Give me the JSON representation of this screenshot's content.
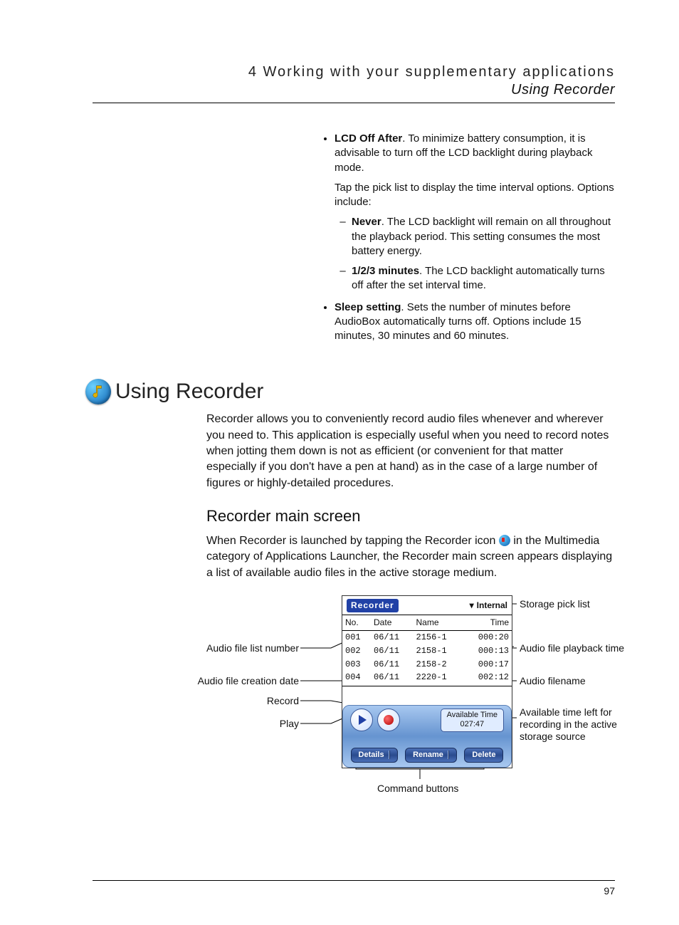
{
  "header": {
    "chapter": "4 Working with your supplementary applications",
    "subtitle": "Using Recorder"
  },
  "page_number": "97",
  "top_block": {
    "lcd": {
      "title": "LCD Off After",
      "desc": ". To minimize battery consumption, it is advisable to turn off the LCD backlight during playback mode.",
      "sub": "Tap the pick list to display the time interval options. Options include:",
      "never_t": "Never",
      "never_d": ". The LCD backlight will remain on all throughout the playback period. This setting consumes the most battery energy.",
      "mins_t": "1/2/3 minutes",
      "mins_d": ". The LCD backlight automatically turns off after the set interval time."
    },
    "sleep": {
      "title": "Sleep setting",
      "desc": ". Sets the number of minutes before AudioBox automatically turns off. Options include 15 minutes, 30 minutes and 60 minutes."
    }
  },
  "section": {
    "title": "Using Recorder",
    "intro": "Recorder allows you to conveniently record audio files whenever and wherever you need to. This application is especially useful when you need to record notes when jotting them down is not as efficient (or convenient for that matter especially if you don't have a pen at hand) as in the case of a large number of figures or highly-detailed procedures.",
    "h2": "Recorder main screen",
    "p2a": "When Recorder is launched by tapping the Recorder icon ",
    "p2b": " in the Multimedia category of Applications Launcher, the Recorder main screen appears displaying a list of available audio files in the active storage medium."
  },
  "recorder": {
    "app_label": "Recorder",
    "picklist": "Internal",
    "cols": {
      "no": "No.",
      "date": "Date",
      "name": "Name",
      "time": "Time"
    },
    "rows": [
      {
        "no": "001",
        "date": "06/11",
        "name": "2156-1",
        "time": "000:20"
      },
      {
        "no": "002",
        "date": "06/11",
        "name": "2158-1",
        "time": "000:13"
      },
      {
        "no": "003",
        "date": "06/11",
        "name": "2158-2",
        "time": "000:17"
      },
      {
        "no": "004",
        "date": "06/11",
        "name": "2220-1",
        "time": "002:12"
      }
    ],
    "avail_label": "Available Time",
    "avail_value": "027:47",
    "cmds": {
      "details": "Details",
      "rename": "Rename",
      "delete": "Delete"
    }
  },
  "callouts": {
    "storage_pick": "Storage pick list",
    "file_no": "Audio file list number",
    "playback_time": "Audio file playback time",
    "creation_date": "Audio file creation date",
    "filename": "Audio filename",
    "record": "Record",
    "play": "Play",
    "avail": "Available time left for recording in the active storage source",
    "cmd_buttons": "Command buttons"
  }
}
